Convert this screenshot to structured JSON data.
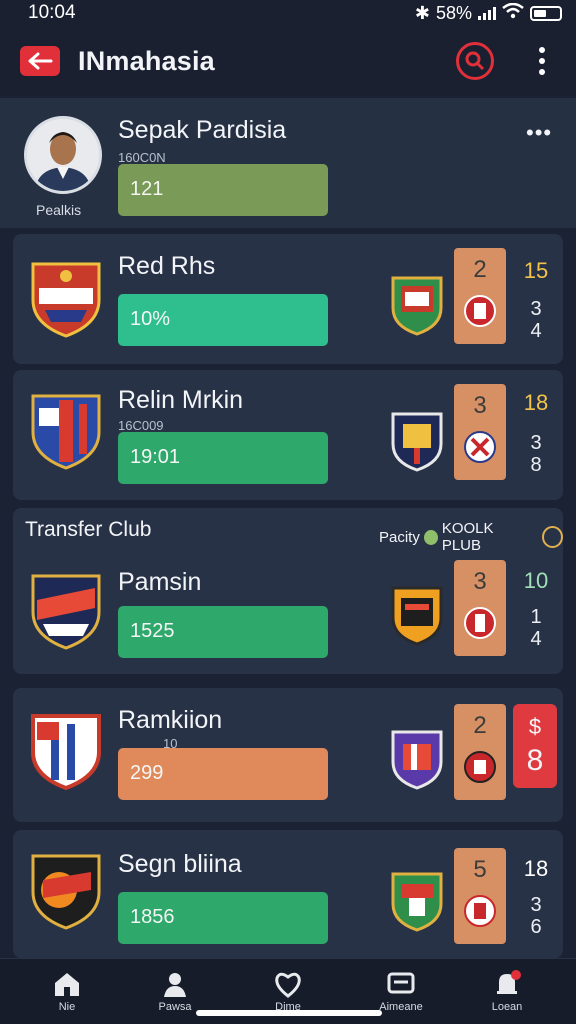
{
  "status": {
    "time": "10:04",
    "battery": "58%"
  },
  "app": {
    "title": "INmahasia"
  },
  "profile": {
    "name": "Sepak Pardisia",
    "sub": "160C0N",
    "bar_value": "121",
    "caption": "Pealkis",
    "more": "•••"
  },
  "cards": [
    {
      "name": "Red Rhs",
      "sub": "",
      "bar_value": "10%",
      "box_score": "2",
      "stat_top": "15",
      "stat_mid": "3",
      "stat_bot": "4"
    },
    {
      "name": "Relin Mrkin",
      "sub": "16C009",
      "bar_value": "19:01",
      "box_score": "3",
      "stat_top": "18",
      "stat_mid": "3",
      "stat_bot": "8"
    }
  ],
  "section": {
    "title": "Transfer Club",
    "right_label": "Pacity",
    "right_label2": "KOOLK PLUB",
    "card": {
      "name": "Pamsin",
      "bar_value": "1525",
      "box_score": "3",
      "stat_top": "10",
      "stat_mid": "1",
      "stat_bot": "4"
    }
  },
  "cards2": [
    {
      "name": "Ramkiion",
      "sub": "10",
      "bar_value": "299",
      "box_score": "2",
      "red_top": "$",
      "red_bot": "8"
    },
    {
      "name": "Segn bliina",
      "sub": "",
      "bar_value": "1856",
      "box_score": "5",
      "stat_top": "18",
      "stat_mid": "3",
      "stat_bot": "6"
    }
  ],
  "nav": [
    {
      "label": "Nie",
      "icon": "home-icon"
    },
    {
      "label": "Pawsa",
      "icon": "person-icon"
    },
    {
      "label": "Dime",
      "icon": "heart-icon"
    },
    {
      "label": "Aimeane",
      "icon": "message-icon"
    },
    {
      "label": "Loean",
      "icon": "bell-icon"
    }
  ],
  "colors": {
    "accent": "#e2303a",
    "teal": "#2fbf8f",
    "green": "#2ea86b",
    "orange": "#e0895a",
    "score_box": "#d79064",
    "background": "#1b2233"
  }
}
